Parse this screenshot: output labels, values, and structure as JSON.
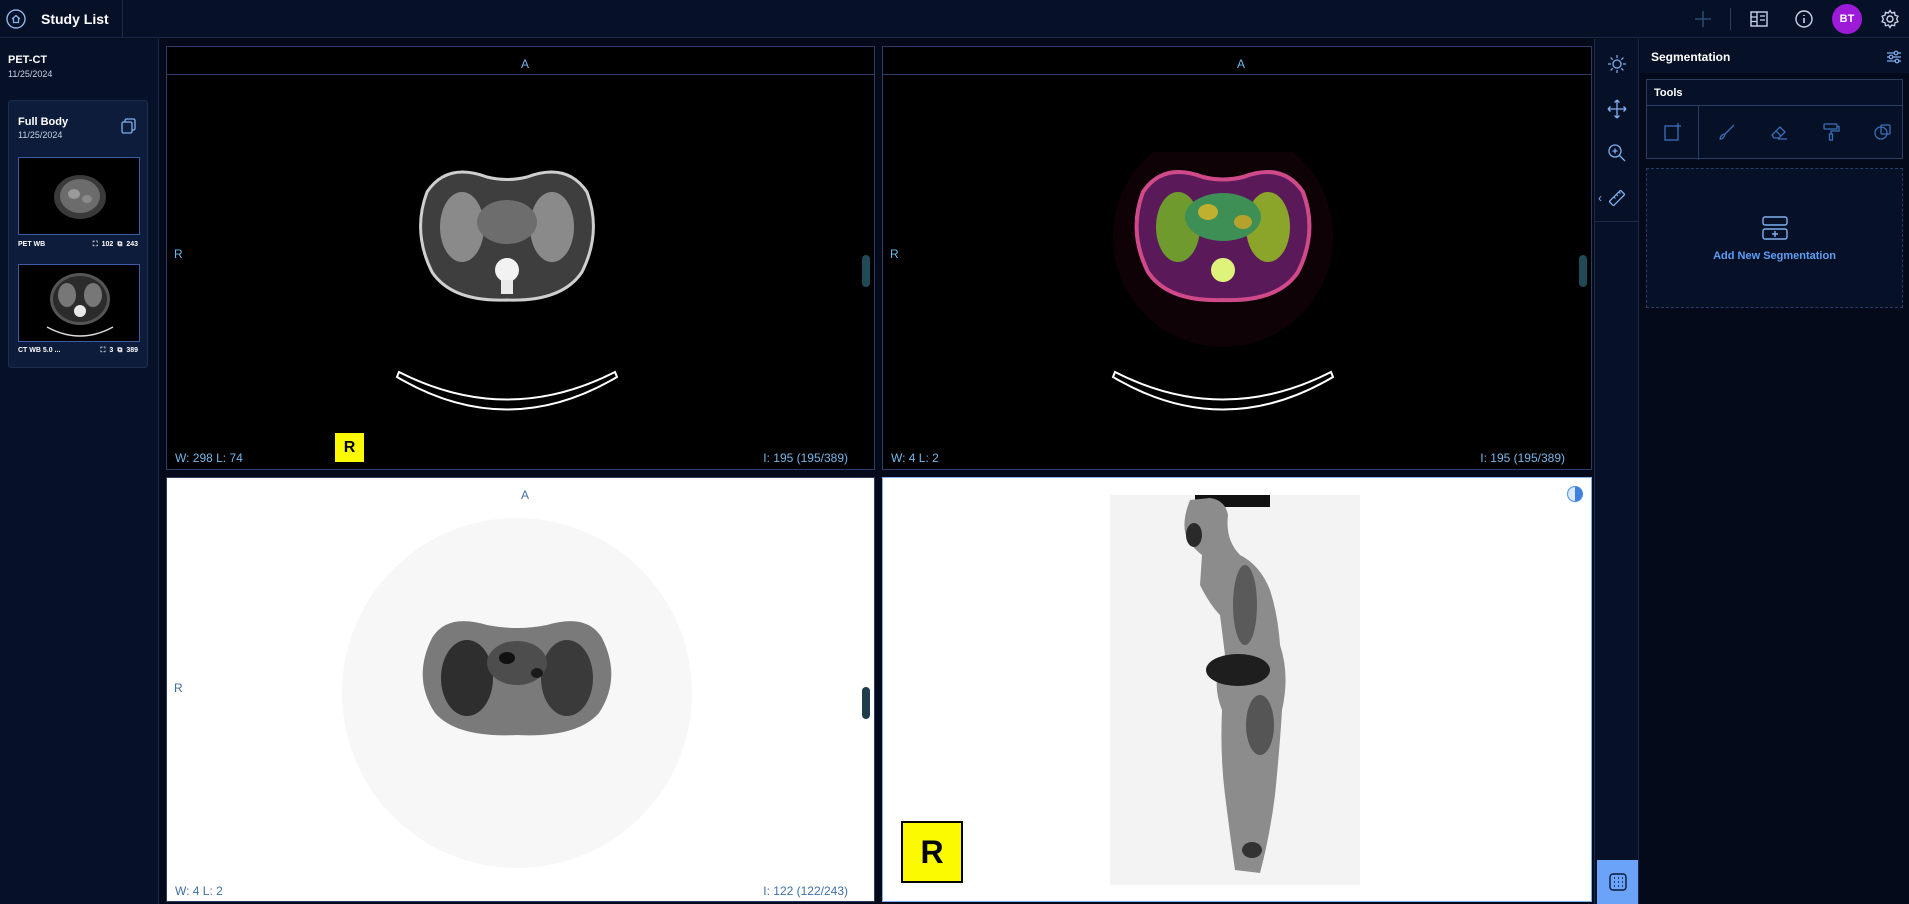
{
  "topbar": {
    "title": "Study List",
    "avatar_initials": "BT",
    "icons": [
      "home-icon",
      "crosshair-icon",
      "layout-icon",
      "info-icon",
      "settings-icon"
    ]
  },
  "study": {
    "modality": "PET-CT",
    "date": "11/25/2024",
    "card": {
      "title": "Full Body",
      "date": "11/25/2024",
      "series": [
        {
          "label": "PET WB",
          "frames": "102",
          "instances": "243"
        },
        {
          "label": "CT WB 5.0 ...",
          "frames": "3",
          "instances": "389"
        }
      ]
    }
  },
  "viewports": {
    "vp1": {
      "orient_top": "A",
      "orient_left": "R",
      "wl": "W:  298  L:  74",
      "instance": "I: 195 (195/389)",
      "marker": "R"
    },
    "vp2": {
      "orient_top": "A",
      "orient_left": "R",
      "wl": "W:  4  L:  2",
      "instance": "I: 195 (195/389)"
    },
    "vp3": {
      "orient_top": "A",
      "orient_left": "R",
      "wl": "W:  4  L:  2",
      "instance": "I: 122 (122/243)"
    },
    "vp4": {
      "marker": "R"
    }
  },
  "tools": {
    "icons": [
      "window-level-icon",
      "pan-icon",
      "zoom-icon",
      "measure-icon"
    ],
    "collapse": "‹"
  },
  "segmentation": {
    "title": "Segmentation",
    "tools_label": "Tools",
    "tool_icons": [
      "add-segment-icon",
      "brush-icon",
      "eraser-icon",
      "paint-roller-icon",
      "shapes-icon"
    ],
    "add_label": "Add New Segmentation"
  },
  "colors": {
    "background": "#040a1a",
    "panel": "#061027",
    "accent": "#5f9ef5",
    "avatar": "#9d1ad8",
    "marker": "#fbfa00"
  }
}
